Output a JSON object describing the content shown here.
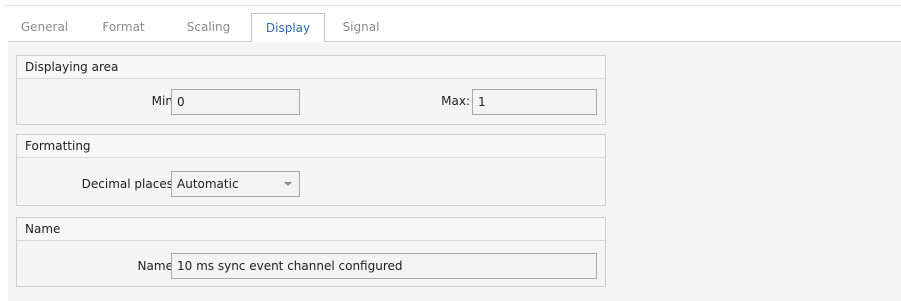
{
  "tabs": [
    {
      "label": "General",
      "active": false
    },
    {
      "label": "Format",
      "active": false
    },
    {
      "label": "Scaling",
      "active": false
    },
    {
      "label": "Display",
      "active": true
    },
    {
      "label": "Signal",
      "active": false
    }
  ],
  "groups": {
    "displaying_area": {
      "title": "Displaying area",
      "min_label": "Min:",
      "min_value": "0",
      "max_label": "Max:",
      "max_value": "1"
    },
    "formatting": {
      "title": "Formatting",
      "decimal_places_label": "Decimal places:",
      "decimal_places_value": "Automatic"
    },
    "name": {
      "title": "Name",
      "name_label": "Name:",
      "name_value": "10 ms sync event channel configured"
    }
  },
  "colors": {
    "active_tab_text": "#2e6cb8",
    "inactive_tab_text": "#8b8b8b",
    "panel_background": "#f5f5f5"
  },
  "icons": {
    "combo_arrow": "chevron-down-icon"
  }
}
